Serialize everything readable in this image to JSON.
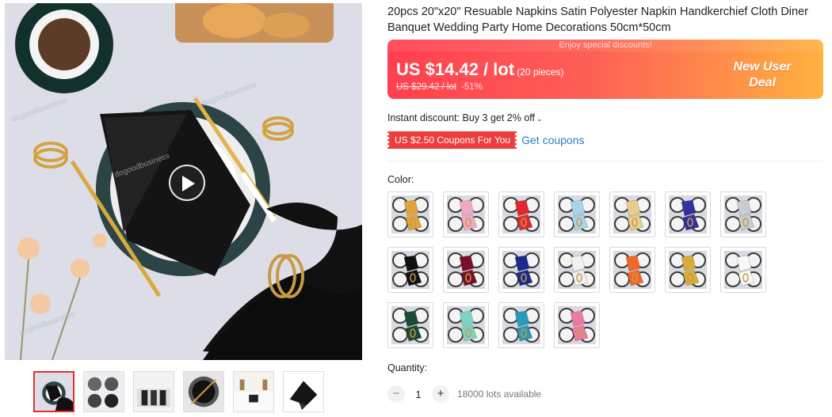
{
  "product": {
    "title": "20pcs 20\"x20\" Resuable Napkins Satin Polyester Napkin Handkerchief Cloth Diner Banquet Wedding Party Home Decorations 50cm*50cm"
  },
  "gallery": {
    "watermark": "dogoodbusiness",
    "thumbnails": [
      {
        "scheme": "black-set",
        "active": true
      },
      {
        "scheme": "grid-set",
        "active": false
      },
      {
        "scheme": "table",
        "active": false
      },
      {
        "scheme": "plate",
        "active": false
      },
      {
        "scheme": "banquet",
        "active": false
      },
      {
        "scheme": "folded",
        "active": false
      }
    ]
  },
  "price": {
    "promo_tag": "Enjoy special discounts!",
    "current": "US $14.42 / lot",
    "pieces": "(20 pieces)",
    "original": "US $29.42 / lot",
    "discount": "-51%",
    "badge_line1": "New User",
    "badge_line2": "Deal"
  },
  "instant_discount": {
    "text": "Instant discount: Buy 3 get 2% off",
    "chevron": "chevron-down-icon"
  },
  "coupon": {
    "label": "US $2.50 Coupons For You",
    "link": "Get coupons"
  },
  "color": {
    "label": "Color:",
    "swatches": [
      "#e0a43a",
      "#f0a9c0",
      "#e0282e",
      "#a8d4ea",
      "#e6cf8a",
      "#33319a",
      "#c9ccd2",
      "#111111",
      "#7a1026",
      "#1c2a8c",
      "#f0f0f0",
      "#f2682a",
      "#d9ad3c",
      "#f8f8f8",
      "#1c4a35",
      "#7cd3c5",
      "#2a9bb7",
      "#ea79a6"
    ]
  },
  "quantity": {
    "label": "Quantity:",
    "minus": "−",
    "value": "1",
    "plus": "+",
    "available": "18000 lots available"
  },
  "colors": {
    "accent_red": "#ec3e3e",
    "link_blue": "#2e7cc4",
    "price_gradient_start": "#ff3f4f",
    "price_gradient_end": "#ffb23f"
  }
}
